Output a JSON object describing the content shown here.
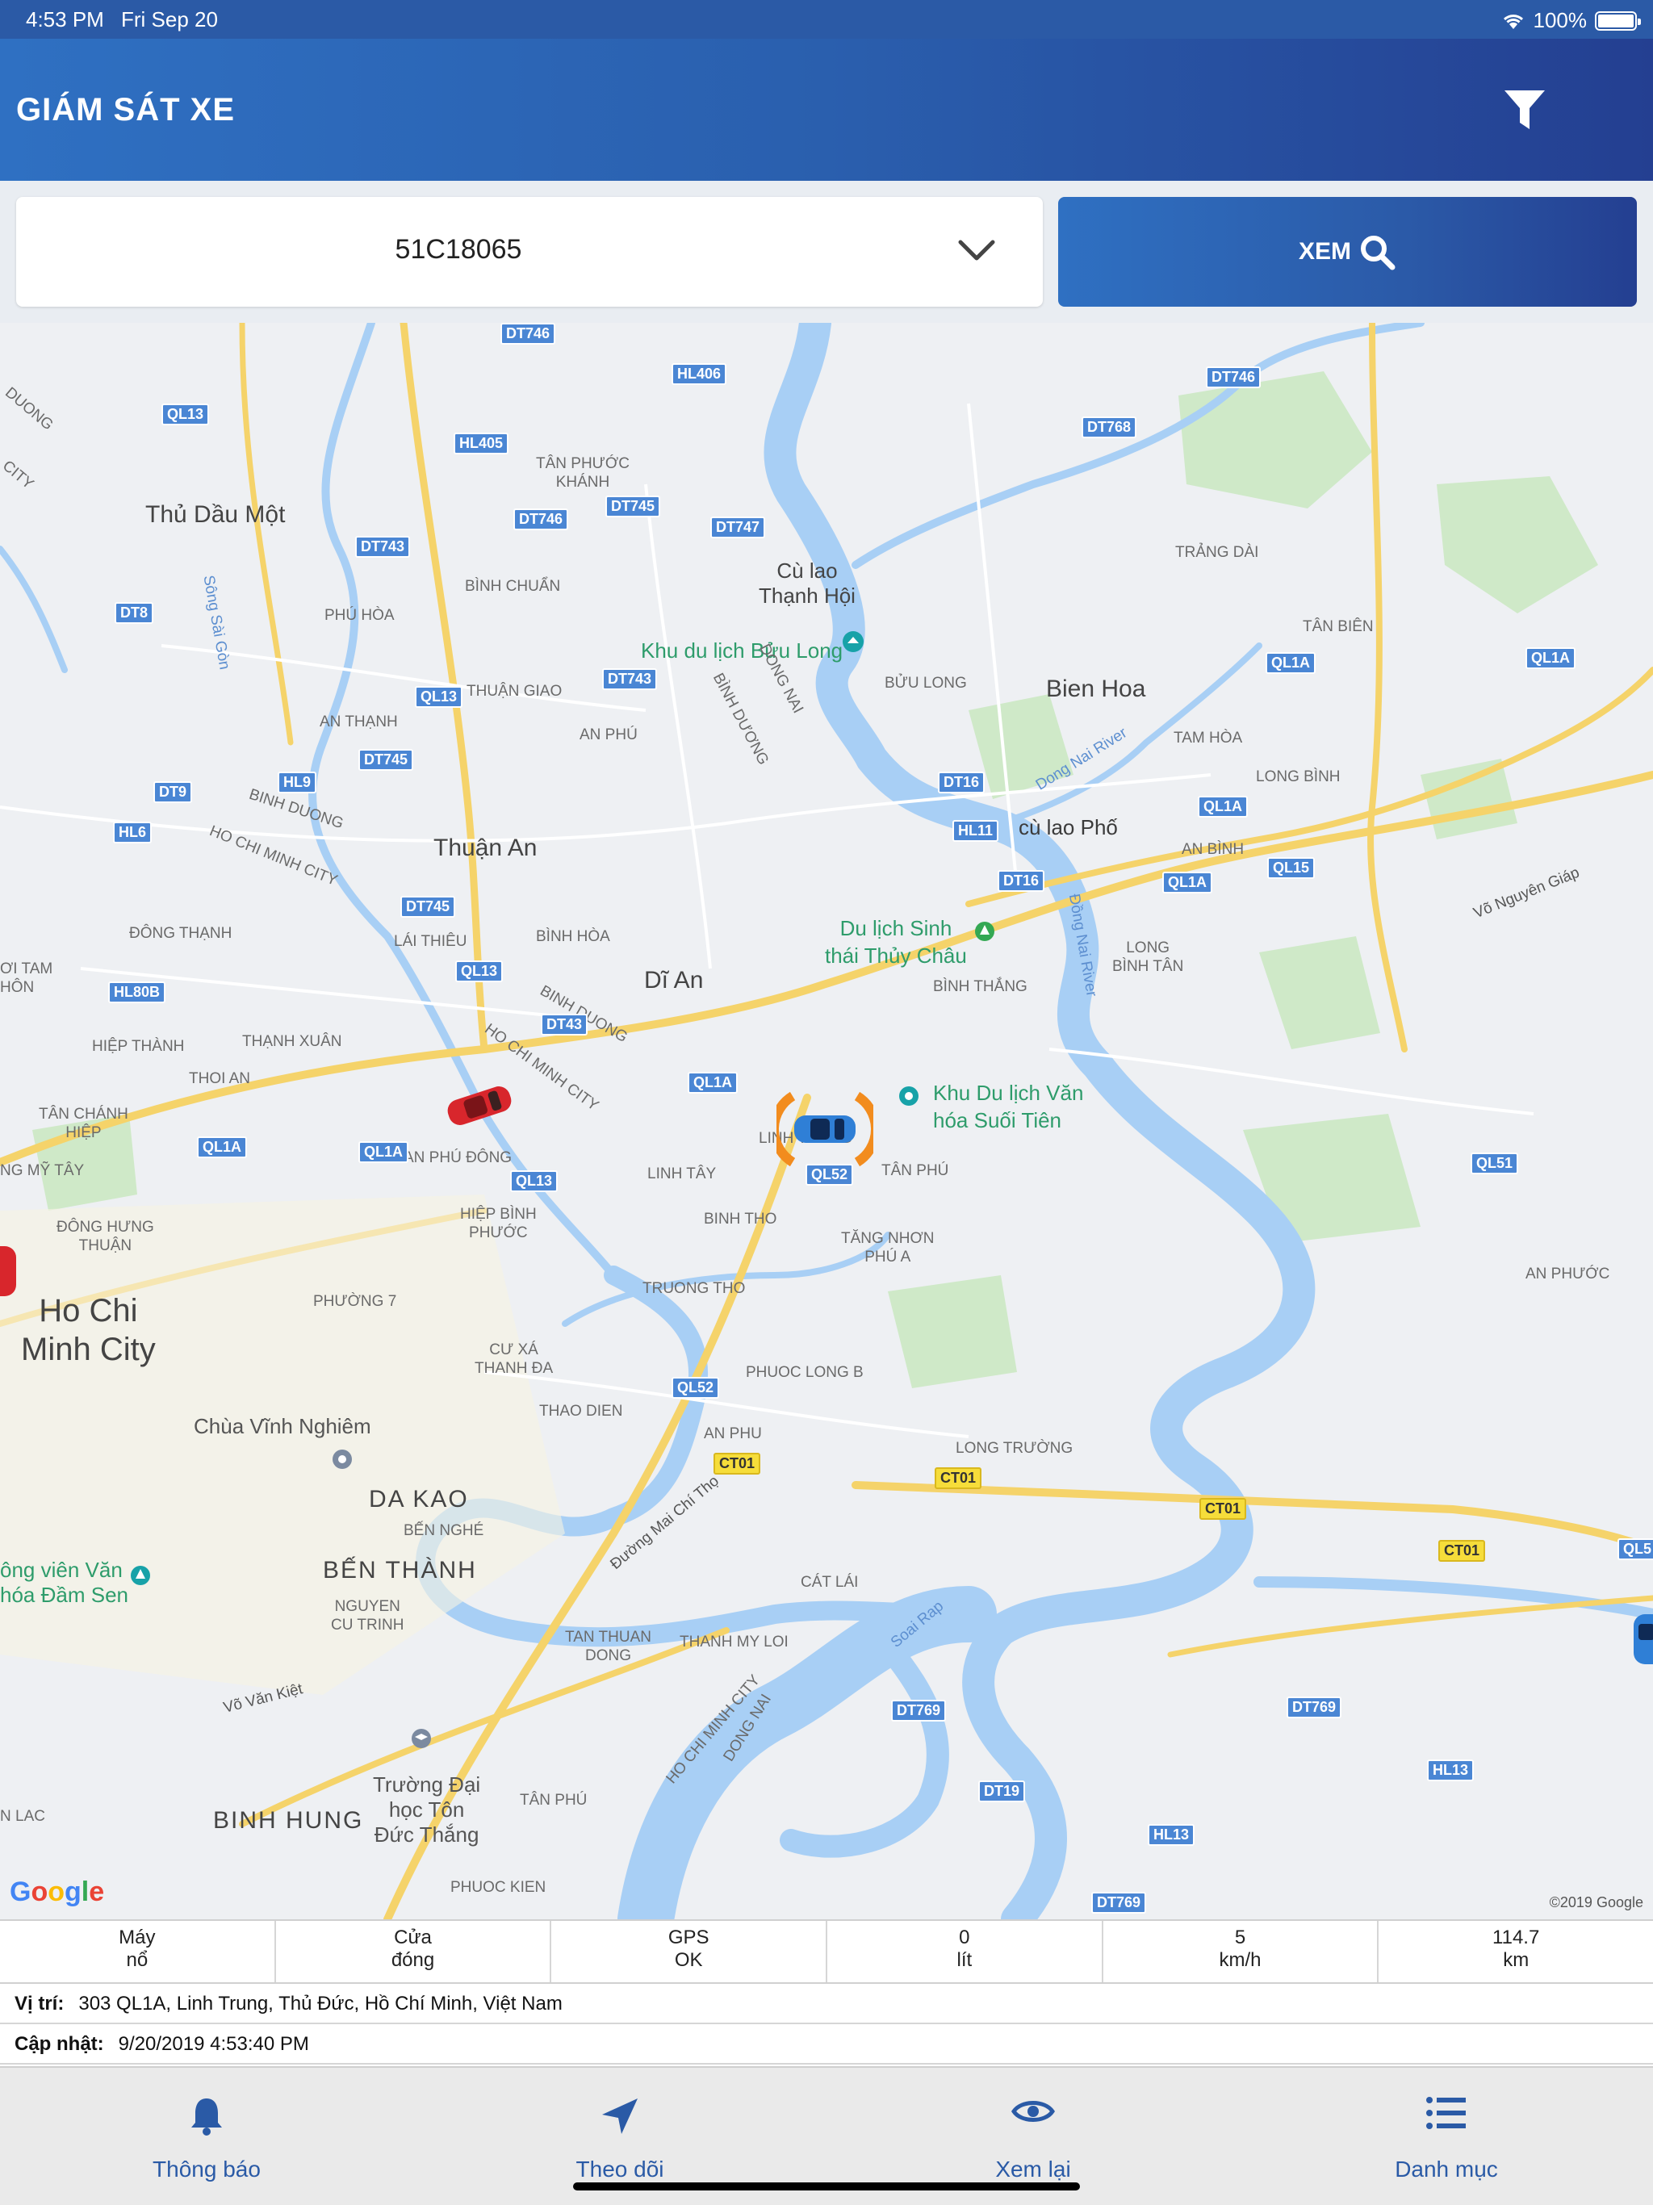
{
  "status_bar": {
    "time": "4:53 PM",
    "date": "Fri Sep 20",
    "battery": "100%"
  },
  "header": {
    "title": "GIÁM SÁT XE",
    "filter_icon": "filter-icon"
  },
  "search": {
    "selected_vehicle": "51C18065",
    "button_label": "XEM"
  },
  "map": {
    "attribution": "©2019 Google",
    "cities": [
      "Thủ Dầu Một",
      "Thuận An",
      "Dĩ An",
      "Bien Hoa",
      "Ho Chi\nMinh City",
      "DA KAO",
      "BẾN THÀNH",
      "BINH HUNG",
      "cù lao Phố"
    ],
    "districts": [
      "TÂN PHƯỚC\nKHÁNH",
      "BÌNH CHUẨN",
      "PHÚ HÒA",
      "THUẬN GIAO",
      "AN THẠNH",
      "AN PHÚ",
      "BÌNH HÒA",
      "ĐÔNG THẠNH",
      "LÁI THIÊU",
      "HIỆP THÀNH",
      "THẠNH XUÂN",
      "THOI AN",
      "TÂN CHÁNH\nHIỆP",
      "ĐÔNG HƯNG\nTHUẬN",
      "AN PHÚ ĐÔNG",
      "HIỆP BÌNH\nPHƯỚC",
      "PHƯỜNG 7",
      "LINH TÂY",
      "BINH THO",
      "TRUONG THO",
      "TĂNG NHƠN\nPHÚ A",
      "TÂN PHÚ",
      "PHUOC LONG B",
      "THAO DIEN",
      "AN PHU",
      "LONG TRƯỜNG",
      "CÁT LÁI",
      "TAN THUAN\nDONG",
      "THANH MY LOI",
      "BẾN NGHÉ",
      "NGUYEN\nCU TRINH",
      "TÂN PHÚ",
      "PHUOC KIEN",
      "TRẢNG DÀI",
      "TÂN BIÊN",
      "BỬU LONG",
      "TAM HÒA",
      "LONG BÌNH",
      "AN BÌNH",
      "LONG\nBÌNH TÂN",
      "BÌNH THẮNG",
      "AN PHƯỚC",
      "CƯ XÁ\nTHANH ĐA",
      "LINH TRUNG",
      "ƠI TAM\nHÔN",
      "NG MỸ TÂY",
      "N LAC"
    ],
    "pois": [
      "Cù lao\nThạnh Hội",
      "Khu du lịch Bửu Long",
      "Du lịch Sinh\nthái Thủy Châu",
      "Khu Du lịch Văn\nhóa Suối Tiên",
      "Chùa Vĩnh Nghiêm",
      "ông viên Văn\nhóa Đầm Sen",
      "Trường Đại\nhọc Tôn\nĐức Thắng"
    ],
    "road_labels": [
      "Sông Sài Gòn",
      "Dong Nai River",
      "Đồng Nai River",
      "Võ Nguyên Giáp",
      "Đường Mai Chí Thọ",
      "Võ Văn Kiệt",
      "Soai Rap",
      "BINH DUONG",
      "HO CHI MINH CITY",
      "DONG NAI",
      "BÌNH DƯƠNG",
      "HO CHI MINH CITY",
      "DONG NAI",
      "BINH DUONG",
      "HO CHI MINH CITY",
      "DUONG",
      "CITY"
    ],
    "shields_blue": [
      "DT746",
      "HL406",
      "DT746",
      "QL13",
      "DT768",
      "HL405",
      "DT745",
      "DT746",
      "DT747",
      "DT743",
      "DT8",
      "QL1A",
      "QL1A",
      "DT743",
      "QL13",
      "DT745",
      "HL9",
      "DT16",
      "HL11",
      "QL1A",
      "DT9",
      "HL6",
      "DT16",
      "QL1A",
      "QL15",
      "DT745",
      "QL13",
      "HL80B",
      "DT43",
      "QL1A",
      "QL1A",
      "QL1A",
      "QL13",
      "QL52",
      "QL51",
      "QL52",
      "DT769",
      "DT769",
      "DT19",
      "HL13",
      "HL13",
      "DT769",
      "QL5"
    ],
    "shields_yellow": [
      "CT01",
      "CT01",
      "CT01",
      "CT01"
    ]
  },
  "stats": [
    {
      "line1": "Máy",
      "line2": "nổ"
    },
    {
      "line1": "Cửa",
      "line2": "đóng"
    },
    {
      "line1": "GPS",
      "line2": "OK"
    },
    {
      "line1": "0",
      "line2": "lít"
    },
    {
      "line1": "5",
      "line2": "km/h"
    },
    {
      "line1": "114.7",
      "line2": "km"
    }
  ],
  "location": {
    "label": "Vị trí:",
    "value": "303 QL1A, Linh Trung, Thủ Đức, Hồ Chí Minh, Việt Nam"
  },
  "updated": {
    "label": "Cập nhật:",
    "value": "9/20/2019 4:53:40 PM"
  },
  "tabs": [
    {
      "label": "Thông báo",
      "icon": "bell-icon"
    },
    {
      "label": "Theo dõi",
      "icon": "navigation-arrow-icon"
    },
    {
      "label": "Xem lại",
      "icon": "eye-icon"
    },
    {
      "label": "Danh mục",
      "icon": "list-icon"
    }
  ],
  "colors": {
    "primary": "#2a5fae",
    "accent_dark": "#243f91",
    "water": "#a8cff5",
    "park": "#cfe9c8"
  }
}
